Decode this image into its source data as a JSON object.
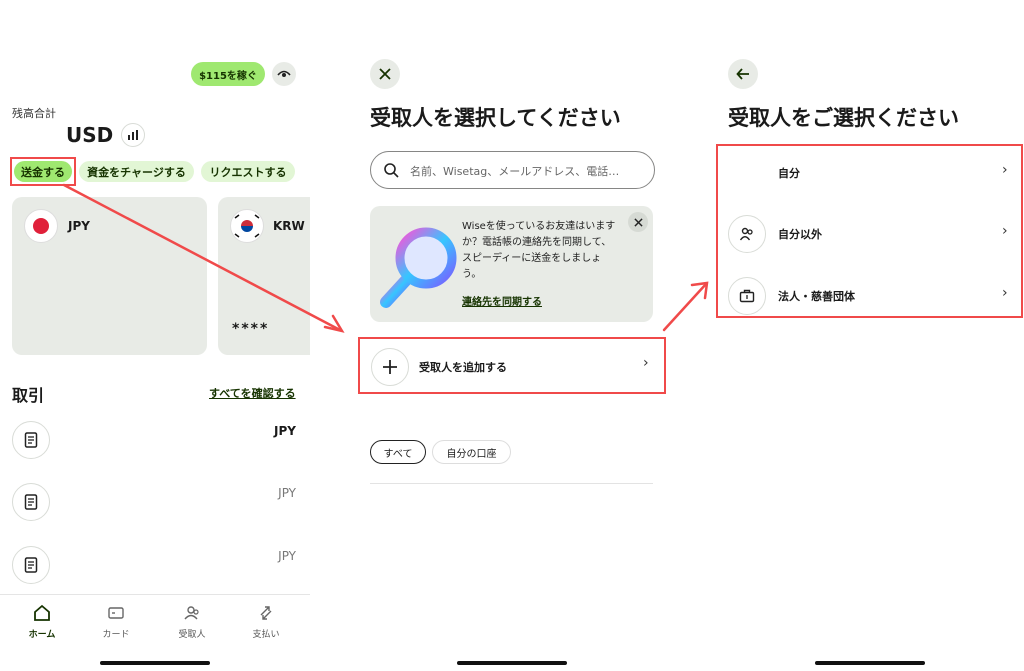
{
  "screen1": {
    "earn_label": "$115を稼ぐ",
    "balance_label": "残高合計",
    "currency": "USD",
    "actions": [
      "送金する",
      "資金をチャージする",
      "リクエストする"
    ],
    "accounts": [
      {
        "code": "JPY",
        "masked": ""
      },
      {
        "code": "KRW",
        "masked": "****"
      }
    ],
    "transactions_title": "取引",
    "see_all": "すべてを確認する",
    "transactions": [
      {
        "currency": "JPY"
      },
      {
        "currency": "JPY"
      },
      {
        "currency": "JPY"
      }
    ],
    "nav": [
      "ホーム",
      "カード",
      "受取人",
      "支払い"
    ]
  },
  "screen2": {
    "title": "受取人を選択してください",
    "search_placeholder": "名前、Wisetag、メールアドレス、電話…",
    "promo_text": "Wiseを使っているお友達はいますか？電話帳の連絡先を同期して、スピーディーに送金をしましょう。",
    "promo_link": "連絡先を同期する",
    "add_recipient": "受取人を追加する",
    "filters": [
      "すべて",
      "自分の口座"
    ]
  },
  "screen3": {
    "title": "受取人をご選択ください",
    "options": [
      "自分",
      "自分以外",
      "法人・慈善団体"
    ]
  },
  "colors": {
    "accent_green": "#9fe870",
    "light_green": "#e2f6d5",
    "dark_green": "#163300",
    "highlight_red": "#f04a4a"
  }
}
